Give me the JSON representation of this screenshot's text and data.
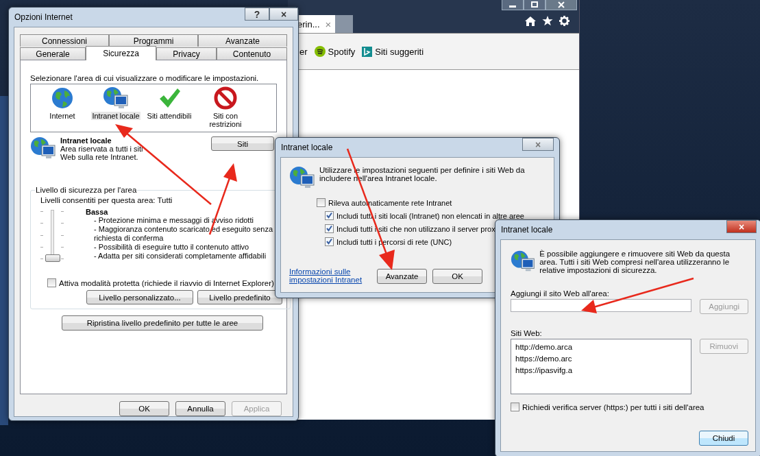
{
  "browser": {
    "tab_title": "erin...",
    "tab_close": "×",
    "favorites": [
      {
        "label": "er",
        "kind": "plain"
      },
      {
        "label": "Spotify",
        "kind": "spotify"
      },
      {
        "label": "Siti suggeriti",
        "kind": "bing"
      }
    ]
  },
  "internet_options": {
    "title": "Opzioni Internet",
    "help": "?",
    "close": "×",
    "tabs_back": [
      {
        "label": "Connessioni",
        "selected": false
      },
      {
        "label": "Programmi",
        "selected": false
      },
      {
        "label": "Avanzate",
        "selected": false
      }
    ],
    "tabs_front": [
      {
        "label": "Generale",
        "selected": false
      },
      {
        "label": "Sicurezza",
        "selected": true
      },
      {
        "label": "Privacy",
        "selected": false
      },
      {
        "label": "Contenuto",
        "selected": false
      }
    ],
    "zone_prompt": "Selezionare l'area di cui visualizzare o modificare le impostazioni.",
    "zones": [
      {
        "label": "Internet",
        "kind": "globe",
        "selected": false
      },
      {
        "label": "Intranet locale",
        "kind": "intranet",
        "selected": true
      },
      {
        "label": "Siti attendibili",
        "kind": "trusted",
        "selected": false
      },
      {
        "label": "Siti con restrizioni",
        "kind": "restricted",
        "selected": false
      }
    ],
    "zone_title": "Intranet locale",
    "zone_description": "Area riservata a tutti i siti Web sulla rete Intranet.",
    "sites_button": "Siti",
    "group_title": "Livello di sicurezza per l'area",
    "allowed_levels": "Livelli consentiti per questa area: Tutti",
    "slider": {
      "level": 0
    },
    "level_name": "Bassa",
    "level_lines": [
      "- Protezione minima e messaggi di avviso ridotti",
      "- Maggioranza contenuto scaricato ed eseguito senza richiesta di conferma",
      "- Possibilità di eseguire tutto il contenuto attivo",
      "- Adatta per siti considerati completamente affidabili"
    ],
    "protected_mode": {
      "label": "Attiva modalità protetta (richiede il riavvio di Internet Explorer)",
      "checked": false
    },
    "custom_level": "Livello personalizzato...",
    "default_level": "Livello predefinito",
    "reset_all": "Ripristina livello predefinito per tutte le aree",
    "footer": [
      {
        "label": "OK",
        "disabled": false
      },
      {
        "label": "Annulla",
        "disabled": false
      },
      {
        "label": "Applica",
        "disabled": true
      }
    ]
  },
  "intranet_dialog": {
    "title": "Intranet locale",
    "close": "×",
    "description": "Utilizzare le impostazioni seguenti per definire i siti Web da includere nell'area Intranet locale.",
    "options": [
      {
        "label": "Rileva automaticamente rete Intranet",
        "checked": false,
        "kind": "main"
      },
      {
        "label": "Includi tutti i siti locali (Intranet) non elencati in altre aree",
        "checked": true,
        "kind": "sub"
      },
      {
        "label": "Includi tutti i siti che non utilizzano il server prox",
        "checked": true,
        "kind": "sub"
      },
      {
        "label": "Includi tutti i percorsi di rete (UNC)",
        "checked": true,
        "kind": "sub"
      }
    ],
    "link": "Informazioni sulle impostazioni Intranet",
    "buttons": [
      "Avanzate",
      "OK"
    ]
  },
  "sites_dialog": {
    "title": "Intranet locale",
    "close": "×",
    "description": "È possibile aggiungere e rimuovere siti Web da questa area. Tutti i siti Web compresi nell'area utilizzeranno le relative impostazioni di sicurezza.",
    "add_label": "Aggiungi il sito Web all'area:",
    "add_button": {
      "label": "Aggiungi",
      "disabled": true
    },
    "list_label": "Siti Web:",
    "sites": [
      "http://demo.arca",
      "https://demo.arc",
      "https://ipasvifg.a"
    ],
    "remove_button": {
      "label": "Rimuovi",
      "disabled": true
    },
    "https_check": {
      "label": "Richiedi verifica server (https:) per tutti i siti dell'area",
      "checked": false
    },
    "close_button": "Chiudi"
  }
}
